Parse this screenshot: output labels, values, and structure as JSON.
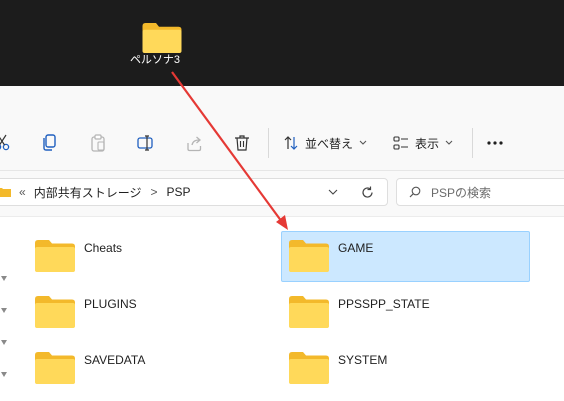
{
  "desktop": {
    "icon_label": "ペルソナ3",
    "icon_name": "folder-icon"
  },
  "toolbar": {
    "sort_label": "並べ替え",
    "view_label": "表示",
    "more_label": "…",
    "icons": [
      "cut-icon",
      "copy-icon",
      "paste-icon",
      "rename-icon",
      "share-icon",
      "delete-icon",
      "sort-icon",
      "view-icon",
      "more-icon"
    ]
  },
  "address": {
    "overflow": "«",
    "crumbs": [
      "内部共有ストレージ",
      "PSP"
    ],
    "separator": ">"
  },
  "search": {
    "placeholder": "PSPの検索"
  },
  "folders": [
    {
      "label": "Cheats",
      "selected": false
    },
    {
      "label": "GAME",
      "selected": true
    },
    {
      "label": "PLUGINS",
      "selected": false
    },
    {
      "label": "PPSSPP_STATE",
      "selected": false
    },
    {
      "label": "SAVEDATA",
      "selected": false
    },
    {
      "label": "SYSTEM",
      "selected": false
    }
  ],
  "colors": {
    "desktop_bg": "#1c1c1c",
    "selection_bg": "#cce8ff",
    "selection_border": "#99d1ff",
    "arrow": "#e53935",
    "folder_front": "#ffd95a",
    "folder_back": "#f3b92b"
  }
}
